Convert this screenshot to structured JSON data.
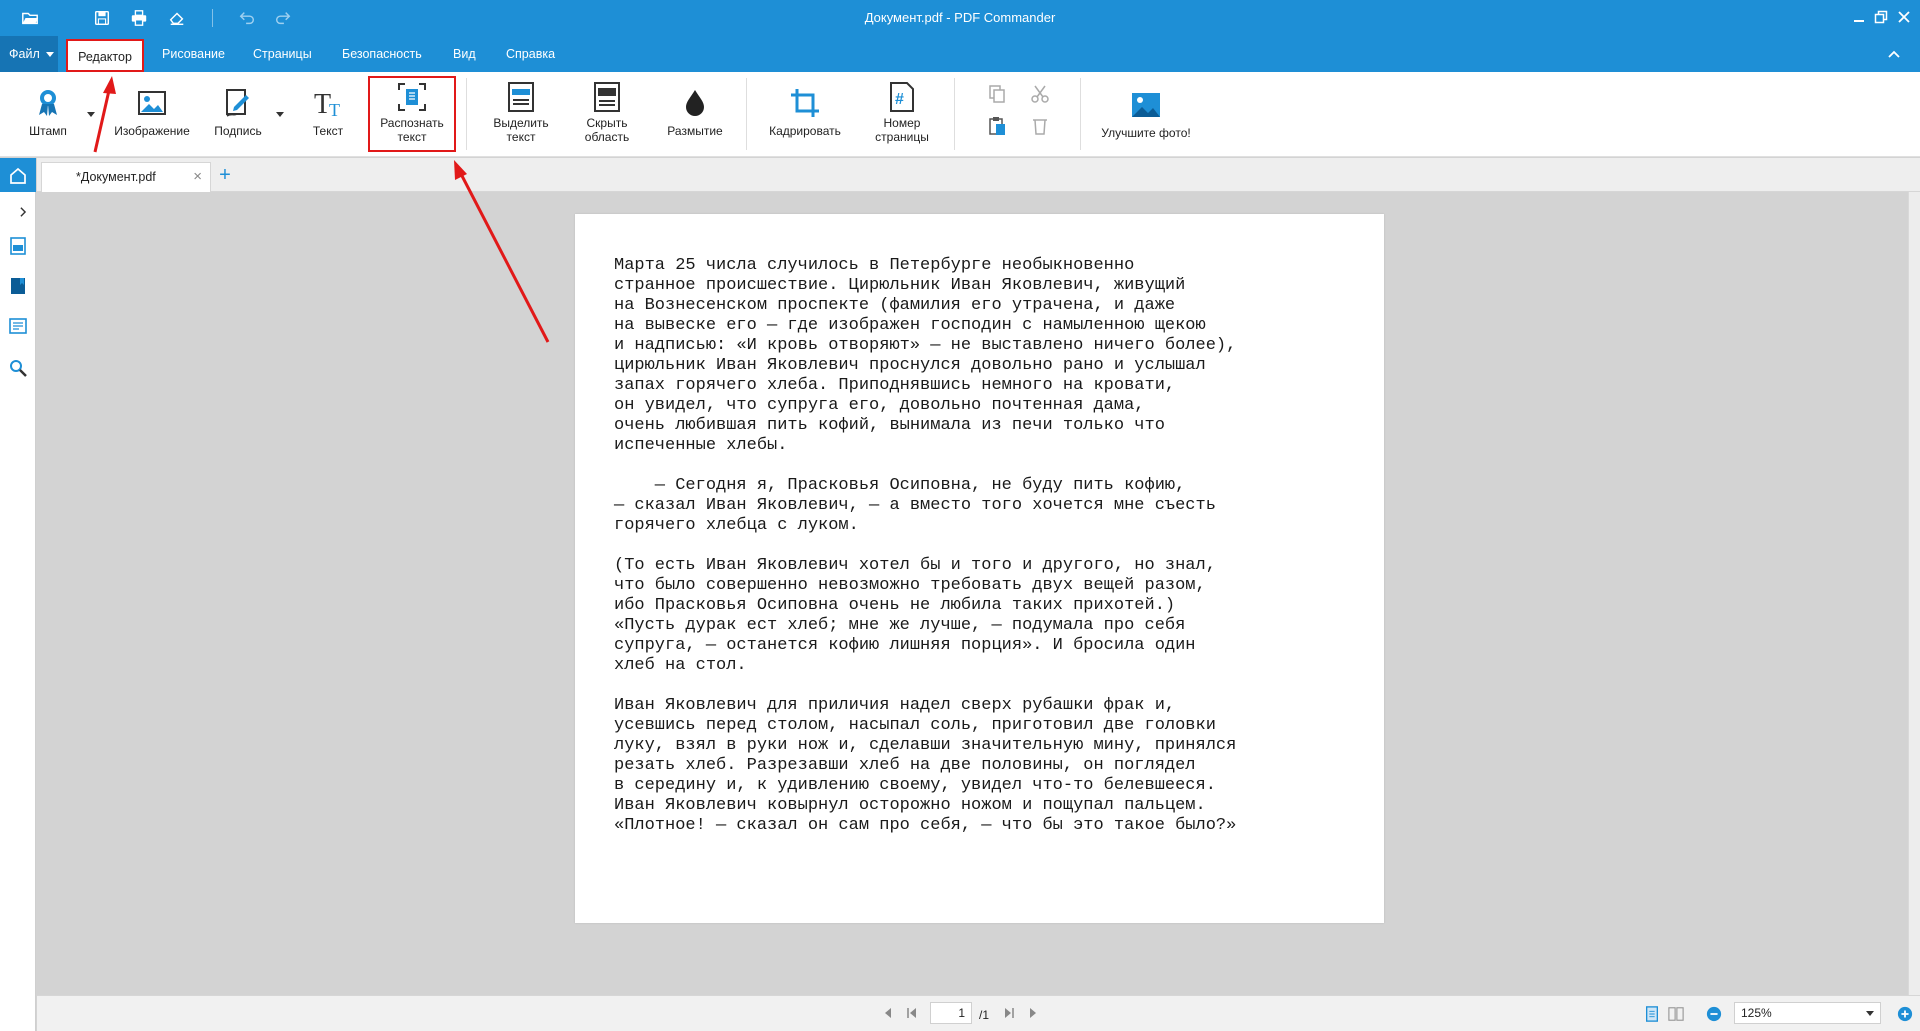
{
  "window": {
    "title": "Документ.pdf - PDF Commander"
  },
  "menu": {
    "file": "Файл",
    "tabs": [
      "Редактор",
      "Рисование",
      "Страницы",
      "Безопасность",
      "Вид",
      "Справка"
    ]
  },
  "ribbon": {
    "stamp": "Штамп",
    "image": "Изображение",
    "signature": "Подпись",
    "text": "Текст",
    "ocr_line1": "Распознать",
    "ocr_line2": "текст",
    "highlight_line1": "Выделить",
    "highlight_line2": "текст",
    "hide_line1": "Скрыть",
    "hide_line2": "область",
    "blur": "Размытие",
    "crop": "Кадрировать",
    "pagenum_line1": "Номер",
    "pagenum_line2": "страницы",
    "enhance": "Улучшите фото!"
  },
  "document_tab": {
    "label": "*Документ.pdf",
    "close": "×",
    "add": "+"
  },
  "document": {
    "lines": [
      "Марта 25 числа случилось в Петербурге необыкновенно",
      "странное происшествие. Цирюльник Иван Яковлевич, живущий",
      "на Вознесенском проспекте (фамилия его утрачена, и даже",
      "на вывеске его — где изображен господин с намыленною щекою",
      "и надписью: «И кровь отворяют» — не выставлено ничего более),",
      "цирюльник Иван Яковлевич проснулся довольно рано и услышал",
      "запах горячего хлеба. Приподнявшись немного на кровати,",
      "он увидел, что супруга его, довольно почтенная дама,",
      "очень любившая пить кофий, вынимала из печи только что",
      "испеченные хлебы.",
      "",
      "    — Сегодня я, Прасковья Осиповна, не буду пить кофию,",
      "— сказал Иван Яковлевич, — а вместо того хочется мне съесть",
      "горячего хлебца с луком.",
      "",
      "(То есть Иван Яковлевич хотел бы и того и другого, но знал,",
      "что было совершенно невозможно требовать двух вещей разом,",
      "ибо Прасковья Осиповна очень не любила таких прихотей.)",
      "«Пусть дурак ест хлеб; мне же лучше, — подумала про себя",
      "супруга, — останется кофию лишняя порция». И бросила один",
      "хлеб на стол.",
      "",
      "Иван Яковлевич для приличия надел сверх рубашки фрак и,",
      "усевшись перед столом, насыпал соль, приготовил две головки",
      "луку, взял в руки нож и, сделавши значительную мину, принялся",
      "резать хлеб. Разрезавши хлеб на две половины, он поглядел",
      "в середину и, к удивлению своему, увидел что-то белевшееся.",
      "Иван Яковлевич ковырнул осторожно ножом и пощупал пальцем.",
      "«Плотное! — сказал он сам про себя, — что бы это такое было?»"
    ]
  },
  "statusbar": {
    "current_page": "1",
    "total_pages": "/1",
    "zoom": "125%"
  },
  "colors": {
    "accent": "#1e8fd6",
    "annotation": "#e11919"
  }
}
